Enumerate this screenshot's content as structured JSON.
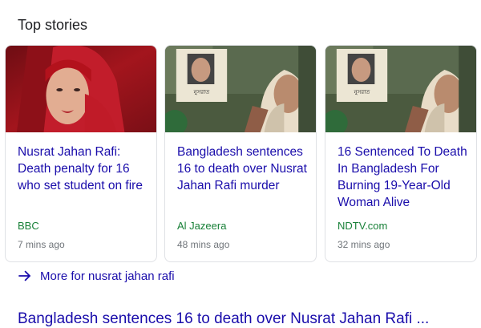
{
  "section": {
    "title": "Top stories"
  },
  "cards": [
    {
      "title": "Nusrat Jahan Rafi: Death penalty for 16 who set student on fire",
      "source": "BBC",
      "time": "7 mins ago"
    },
    {
      "title": "Bangladesh sentences 16 to death over Nusrat Jahan Rafi murder",
      "source": "Al Jazeera",
      "time": "48 mins ago",
      "sign_text": "নুসরাত"
    },
    {
      "title": "16 Sentenced To Death In Bangladesh For Burning 19-Year-Old Woman Alive",
      "source": "NDTV.com",
      "time": "32 mins ago",
      "sign_text": "নুসরাত"
    }
  ],
  "more": {
    "label": "More for nusrat jahan rafi",
    "icon": "arrow-right-icon"
  },
  "next_result": {
    "title": "Bangladesh sentences 16 to death over Nusrat Jahan Rafi ..."
  },
  "colors": {
    "link": "#1a0dab",
    "source": "#188038",
    "meta": "#70757a",
    "border": "#dfe1e5"
  }
}
